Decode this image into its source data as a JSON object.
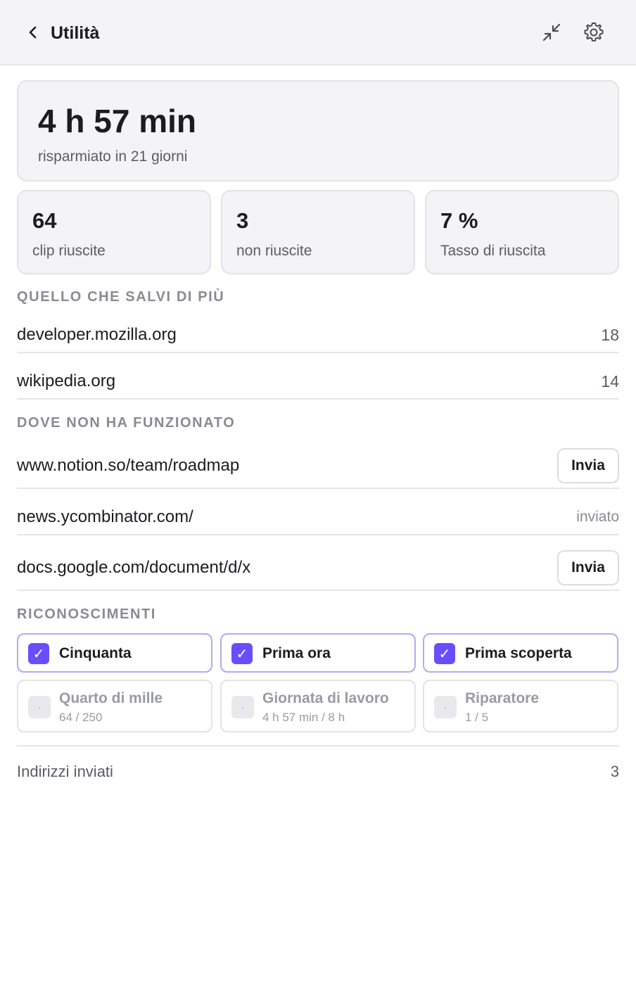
{
  "header": {
    "title": "Utilità",
    "back_icon": "chevron-left-icon",
    "collapse_icon": "collapse-arrows-icon",
    "settings_icon": "gear-icon"
  },
  "hero": {
    "value": "4 h 57 min",
    "subtitle": "risparmiato in 21 giorni"
  },
  "stats": [
    {
      "value": "64",
      "label": "clip riuscite"
    },
    {
      "value": "3",
      "label": "non riuscite"
    },
    {
      "value": "7 %",
      "label": "Tasso di riuscita"
    }
  ],
  "most_saved": {
    "heading": "QUELLO CHE SALVI DI PIÙ",
    "items": [
      {
        "domain": "developer.mozilla.org",
        "count": "18"
      },
      {
        "domain": "wikipedia.org",
        "count": "14"
      }
    ]
  },
  "failed": {
    "heading": "DOVE NON HA FUNZIONATO",
    "items": [
      {
        "url": "www.notion.so/team/roadmap",
        "action": "Invia"
      },
      {
        "url": "news.ycombinator.com/",
        "status": "inviato"
      },
      {
        "url": "docs.google.com/document/d/x",
        "action": "Invia"
      }
    ]
  },
  "achievements": {
    "heading": "RICONOSCIMENTI",
    "unlocked": [
      {
        "label": "Cinquanta",
        "check": "✓"
      },
      {
        "label": "Prima ora",
        "check": "✓"
      },
      {
        "label": "Prima scoperta",
        "check": "✓"
      }
    ],
    "locked": [
      {
        "label": "Quarto di mille",
        "progress": "64 / 250",
        "marker": "·"
      },
      {
        "label": "Giornata di lavoro",
        "progress": "4 h 57 min / 8 h",
        "marker": "·"
      },
      {
        "label": "Riparatore",
        "progress": "1 / 5",
        "marker": "·"
      }
    ]
  },
  "footer": {
    "label": "Indirizzi inviati",
    "count": "3"
  },
  "colors": {
    "accent": "#6a4dff",
    "badge_border": "#b4a9f5",
    "card_bg": "#f4f4f6",
    "muted_text": "#8a8a94"
  }
}
